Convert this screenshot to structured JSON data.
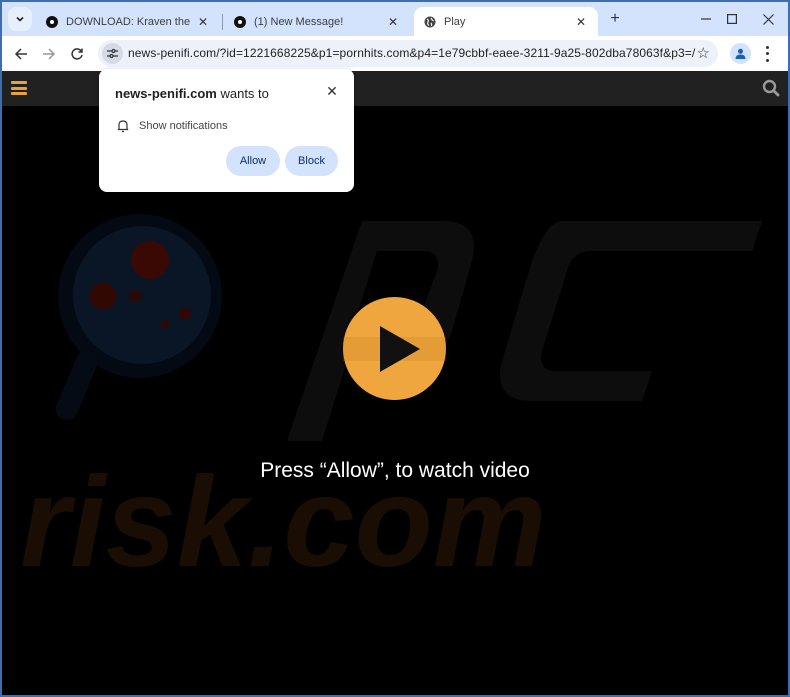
{
  "browser": {
    "tabs": [
      {
        "title": "DOWNLOAD: Kraven the Hunte",
        "icon": "site-favicon",
        "active": false
      },
      {
        "title": "(1) New Message!",
        "icon": "site-favicon",
        "active": false
      },
      {
        "title": "Play",
        "icon": "globe-icon",
        "active": true
      }
    ],
    "new_tab_label": "+",
    "window_controls": {
      "minimize": "—",
      "maximize": "☐",
      "close": "✕"
    },
    "url": "news-penifi.com/?id=1221668225&p1=pornhits.com&p4=1e79cbbf-eaee-3211-9a25-802dba78063f&p3=/",
    "bookmark_icon": "☆"
  },
  "permission_prompt": {
    "site": "news-penifi.com",
    "wants_to": " wants to",
    "permission": "Show notifications",
    "close": "✕",
    "allow_label": "Allow",
    "block_label": "Block"
  },
  "page": {
    "cta": "Press “Allow”, to watch video",
    "accent_color": "#efa63f",
    "watermark_text": "risk.com"
  }
}
